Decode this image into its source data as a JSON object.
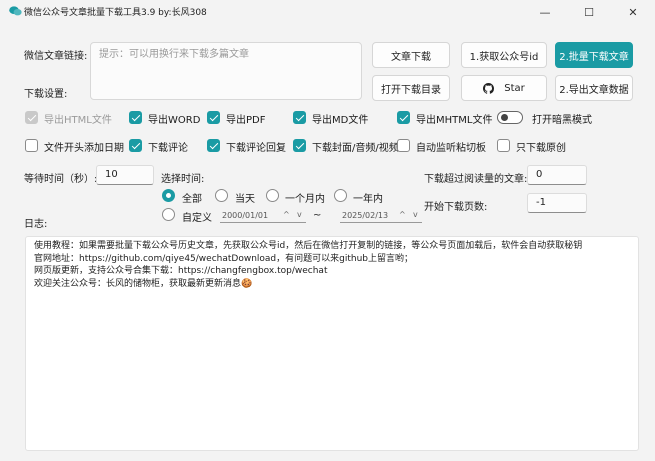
{
  "window": {
    "title": "微信公众号文章批量下载工具3.9 by:长风308",
    "minimize": "—",
    "maximize": "☐",
    "close": "✕"
  },
  "labels": {
    "article_link": "微信文章链接:",
    "download_settings": "下载设置:",
    "wait_time": "等待时间（秒）:",
    "select_time": "选择时间:",
    "skip_read_count": "下载超过阅读量的文章:",
    "start_page": "开始下载页数:",
    "log": "日志:"
  },
  "link_input": {
    "placeholder": "提示：可以用换行来下载多篇文章"
  },
  "buttons": {
    "download_article": "文章下载",
    "get_account_id": "1.获取公众号id",
    "batch_download": "2.批量下载文章",
    "open_download_dir": "打开下载目录",
    "star": "Star",
    "export_article_data": "2.导出文章数据"
  },
  "options_row1": [
    {
      "label": "导出HTML文件",
      "checked": true,
      "disabled": true
    },
    {
      "label": "导出WORD",
      "checked": true,
      "disabled": false
    },
    {
      "label": "导出PDF",
      "checked": true,
      "disabled": false
    },
    {
      "label": "导出MD文件",
      "checked": true,
      "disabled": false
    },
    {
      "label": "导出MHTML文件",
      "checked": true,
      "disabled": false
    }
  ],
  "dark_mode": {
    "label": "打开暗黑模式",
    "on": false
  },
  "options_row2": [
    {
      "label": "文件开头添加日期",
      "checked": false
    },
    {
      "label": "下载评论",
      "checked": true
    },
    {
      "label": "下载评论回复",
      "checked": true
    },
    {
      "label": "下载封面/音频/视频",
      "checked": true
    },
    {
      "label": "自动监听粘切板",
      "checked": false
    },
    {
      "label": "只下载原创",
      "checked": false
    }
  ],
  "wait_time_value": "10",
  "time_options": [
    {
      "label": "全部",
      "selected": true
    },
    {
      "label": "当天",
      "selected": false
    },
    {
      "label": "一个月内",
      "selected": false
    },
    {
      "label": "一年内",
      "selected": false
    }
  ],
  "custom_range": {
    "label": "自定义",
    "selected": false,
    "start": "2000/01/01",
    "end": "2025/02/13",
    "separator": "~",
    "spin_up": "^",
    "spin_down": "v"
  },
  "read_count_value": "0",
  "start_page_value": "-1",
  "log_lines": [
    "使用教程：如果需要批量下载公众号历史文章，先获取公众号id，然后在微信打开复制的链接，等公众号页面加载后，软件会自动获取秘钥",
    "官网地址：https://github.com/qiye45/wechatDownload，有问题可以来github上留言哟；",
    "网页版更新，支持公众号合集下载：https://changfengbox.top/wechat",
    "欢迎关注公众号：长风的储物柜，获取最新更新消息🍪"
  ],
  "colors": {
    "accent": "#1a9ba4",
    "background": "#f3f3f3"
  }
}
